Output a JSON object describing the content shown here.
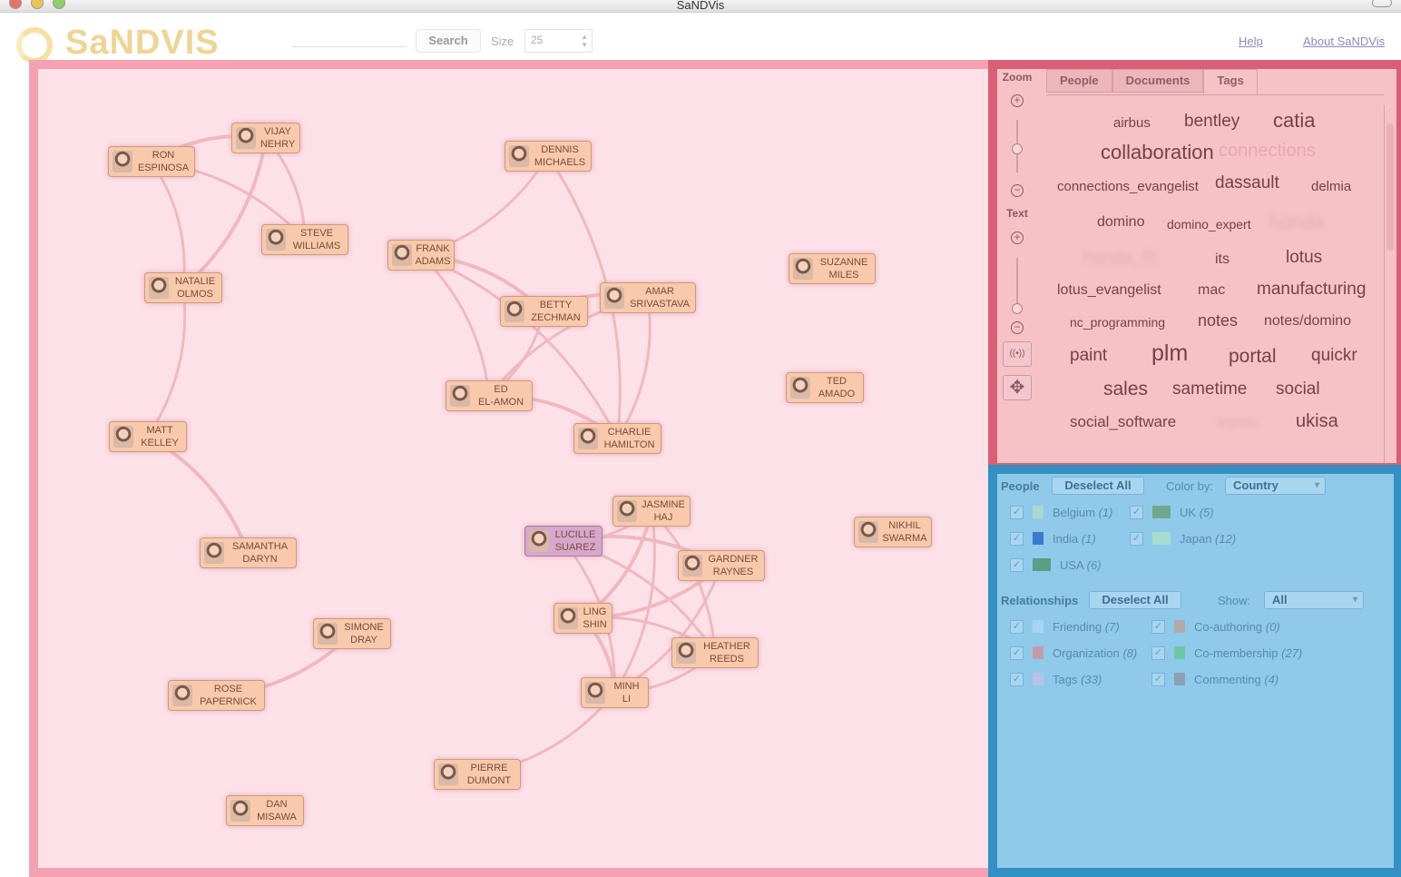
{
  "window": {
    "title": "SaNDVis"
  },
  "toolbar": {
    "logo": "SaNDVIS",
    "search_value": "",
    "search_button": "Search",
    "size_label": "Size",
    "size_value": "25",
    "help_link": "Help",
    "about_link": "About SaNDVis"
  },
  "graph": {
    "people": [
      {
        "name": "RON\nESPINOSA"
      },
      {
        "name": "VIJAY\nNEHRY"
      },
      {
        "name": "DENNIS\nMICHAELS"
      },
      {
        "name": "STEVE\nWILLIAMS"
      },
      {
        "name": "FRANK\nADAMS"
      },
      {
        "name": "NATALIE\nOLMOS"
      },
      {
        "name": "SUZANNE\nMILES"
      },
      {
        "name": "AMAR\nSRIVASTAVA"
      },
      {
        "name": "BETTY\nZECHMAN"
      },
      {
        "name": "TED\nAMADO"
      },
      {
        "name": "ED\nEL-AMON"
      },
      {
        "name": "MATT\nKELLEY"
      },
      {
        "name": "CHARLIE\nHAMILTON"
      },
      {
        "name": "JASMINE\nHAJ"
      },
      {
        "name": "NIKHIL\nSWARMA"
      },
      {
        "name": "LUCILLE\nSUAREZ"
      },
      {
        "name": "SAMANTHA\nDARYN"
      },
      {
        "name": "GARDNER\nRAYNES"
      },
      {
        "name": "LING\nSHIN"
      },
      {
        "name": "SIMONE\nDRAY"
      },
      {
        "name": "HEATHER\nREEDS"
      },
      {
        "name": "ROSE\nPAPERNICK"
      },
      {
        "name": "MINH\nLI"
      },
      {
        "name": "PIERRE\nDUMONT"
      },
      {
        "name": "DAN\nMISAWA"
      }
    ]
  },
  "zoom_panel": {
    "zoom_label": "Zoom",
    "text_label": "Text",
    "plus": "+",
    "minus": "−",
    "radar_icon": "((•))",
    "move_icon": "✥"
  },
  "tabs": {
    "people": "People",
    "documents": "Documents",
    "tags": "Tags"
  },
  "tags": [
    {
      "text": "airbus"
    },
    {
      "text": "bentley"
    },
    {
      "text": "catia"
    },
    {
      "text": "collaboration"
    },
    {
      "text": "connections"
    },
    {
      "text": "connections_evangelist"
    },
    {
      "text": "dassault"
    },
    {
      "text": "delmia"
    },
    {
      "text": "domino"
    },
    {
      "text": "domino_expert"
    },
    {
      "text": "honda"
    },
    {
      "text": "honda_f1"
    },
    {
      "text": "its"
    },
    {
      "text": "lotus"
    },
    {
      "text": "lotus_evangelist"
    },
    {
      "text": "mac"
    },
    {
      "text": "manufacturing"
    },
    {
      "text": "nc_programming"
    },
    {
      "text": "notes"
    },
    {
      "text": "notes/domino"
    },
    {
      "text": "paint"
    },
    {
      "text": "plm"
    },
    {
      "text": "portal"
    },
    {
      "text": "quickr"
    },
    {
      "text": "sales"
    },
    {
      "text": "sametime"
    },
    {
      "text": "social"
    },
    {
      "text": "social_software"
    },
    {
      "text": "toyota"
    },
    {
      "text": "ukisa"
    }
  ],
  "people_filter": {
    "title": "People",
    "deselect": "Deselect All",
    "color_by_label": "Color by:",
    "color_by_value": "Country",
    "countries": [
      {
        "name": "Belgium",
        "count": "(1)",
        "color": "#a9d9c9"
      },
      {
        "name": "UK",
        "count": "(5)",
        "color": "#6fa88a"
      },
      {
        "name": "India",
        "count": "(1)",
        "color": "#3a7ad0"
      },
      {
        "name": "Japan",
        "count": "(12)",
        "color": "#a8dcd0"
      },
      {
        "name": "USA",
        "count": "(6)",
        "color": "#5a9e84"
      }
    ]
  },
  "relationships_filter": {
    "title": "Relationships",
    "deselect": "Deselect All",
    "show_label": "Show:",
    "show_value": "All",
    "types": [
      {
        "name": "Friending",
        "count": "(7)",
        "color": "#a8d4f4"
      },
      {
        "name": "Co-authoring",
        "count": "(0)",
        "color": "#b3a9a9"
      },
      {
        "name": "Organization",
        "count": "(8)",
        "color": "#c79aa8"
      },
      {
        "name": "Co-membership",
        "count": "(27)",
        "color": "#6cc9a8"
      },
      {
        "name": "Tags",
        "count": "(33)",
        "color": "#b7c4ea"
      },
      {
        "name": "Commenting",
        "count": "(4)",
        "color": "#8aa0b4"
      }
    ]
  },
  "colors": {
    "graph_border": "#f4a1b2",
    "graph_bg": "#fde1e8",
    "tag_panel_border": "#d95f77",
    "filter_panel_border": "#3390c3",
    "edge": "#f0b8c0"
  }
}
